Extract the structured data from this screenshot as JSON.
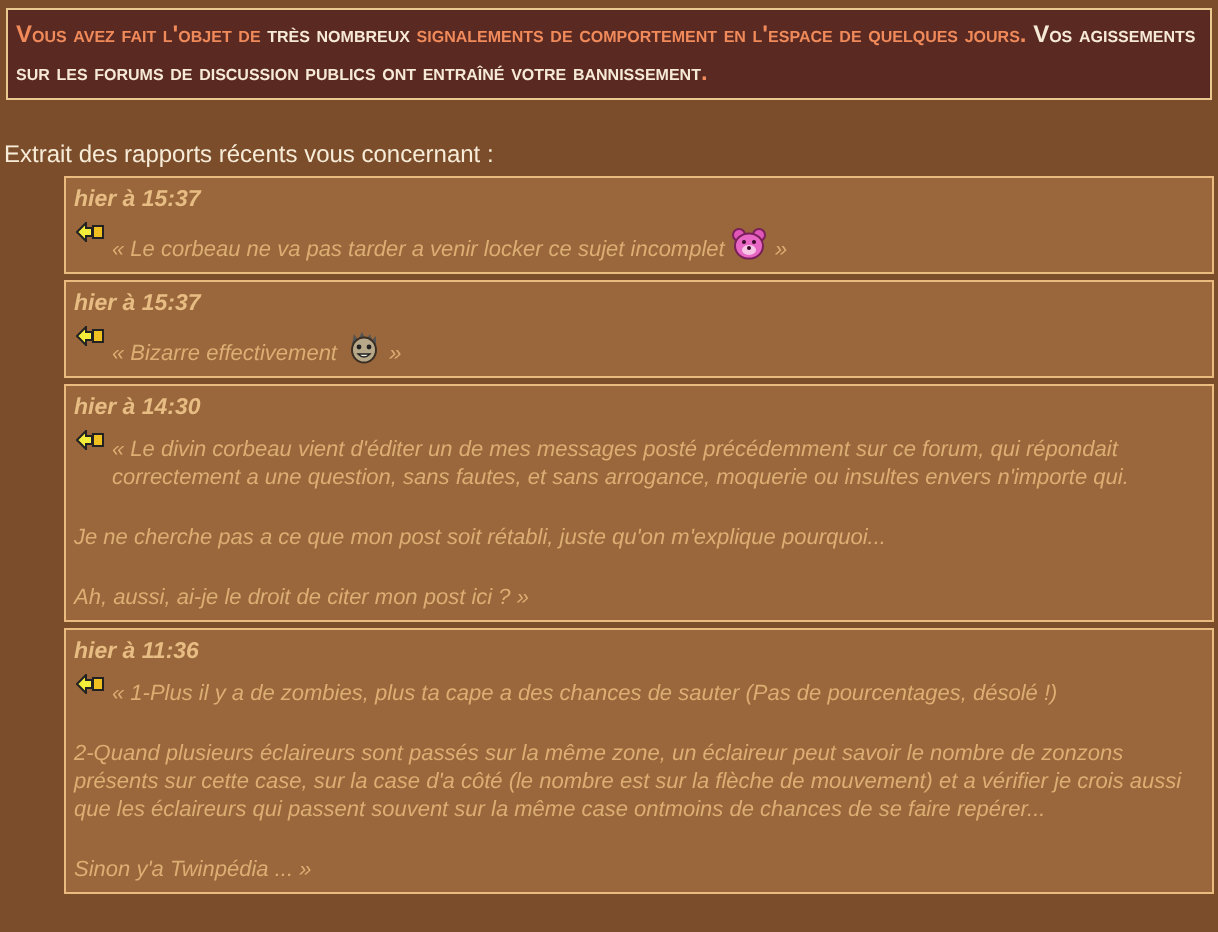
{
  "banner": {
    "segments": [
      {
        "text": "Vous avez fait l'objet de ",
        "emphasis": false
      },
      {
        "text": "très nombreux",
        "emphasis": true
      },
      {
        "text": " signalements de comportement en l'espace de quelques jours.",
        "emphasis": false
      },
      {
        "text": " Vos agissements sur les forums de discussion publics ont entraîné votre bannissement",
        "emphasis": true
      },
      {
        "text": ".",
        "emphasis": false
      }
    ]
  },
  "heading": "Extrait des rapports récents vous concernant :",
  "reports": [
    {
      "date": "hier à 15:37",
      "paragraphs": [
        [
          {
            "kind": "text",
            "text": "« Le corbeau ne va pas tarder a venir locker ce sujet incomplet "
          },
          {
            "kind": "bear"
          },
          {
            "kind": "text",
            "text": " »"
          }
        ]
      ]
    },
    {
      "date": "hier à 15:37",
      "paragraphs": [
        [
          {
            "kind": "text",
            "text": "« Bizarre effectivement "
          },
          {
            "kind": "grin"
          },
          {
            "kind": "text",
            "text": " »"
          }
        ]
      ]
    },
    {
      "date": "hier à 14:30",
      "paragraphs": [
        [
          {
            "kind": "text",
            "text": "« Le divin corbeau vient d'éditer un de mes messages posté précédemment sur ce forum, qui répondait correctement a une question, sans fautes, et sans arrogance, moquerie ou insultes envers n'importe qui."
          }
        ],
        [
          {
            "kind": "text",
            "text": "Je ne cherche pas a ce que mon post soit rétabli, juste qu'on m'explique pourquoi..."
          }
        ],
        [
          {
            "kind": "text",
            "text": "Ah, aussi, ai-je le droit de citer mon post ici ? »"
          }
        ]
      ]
    },
    {
      "date": "hier à 11:36",
      "paragraphs": [
        [
          {
            "kind": "text",
            "text": "« 1-Plus il y a de zombies, plus ta cape a des chances de sauter (Pas de pourcentages, désolé !)"
          }
        ],
        [
          {
            "kind": "text",
            "text": "2-Quand plusieurs éclaireurs sont passés sur la même zone, un éclaireur peut savoir le nombre de zonzons présents sur cette case, sur la case d'a côté (le nombre est sur la flèche de mouvement) et a vérifier je crois aussi que les éclaireurs qui passent souvent sur la même case ontmoins de chances de se faire repérer..."
          }
        ],
        [
          {
            "kind": "text",
            "text": "Sinon y'a Twinpédia ... »"
          }
        ]
      ]
    }
  ]
}
